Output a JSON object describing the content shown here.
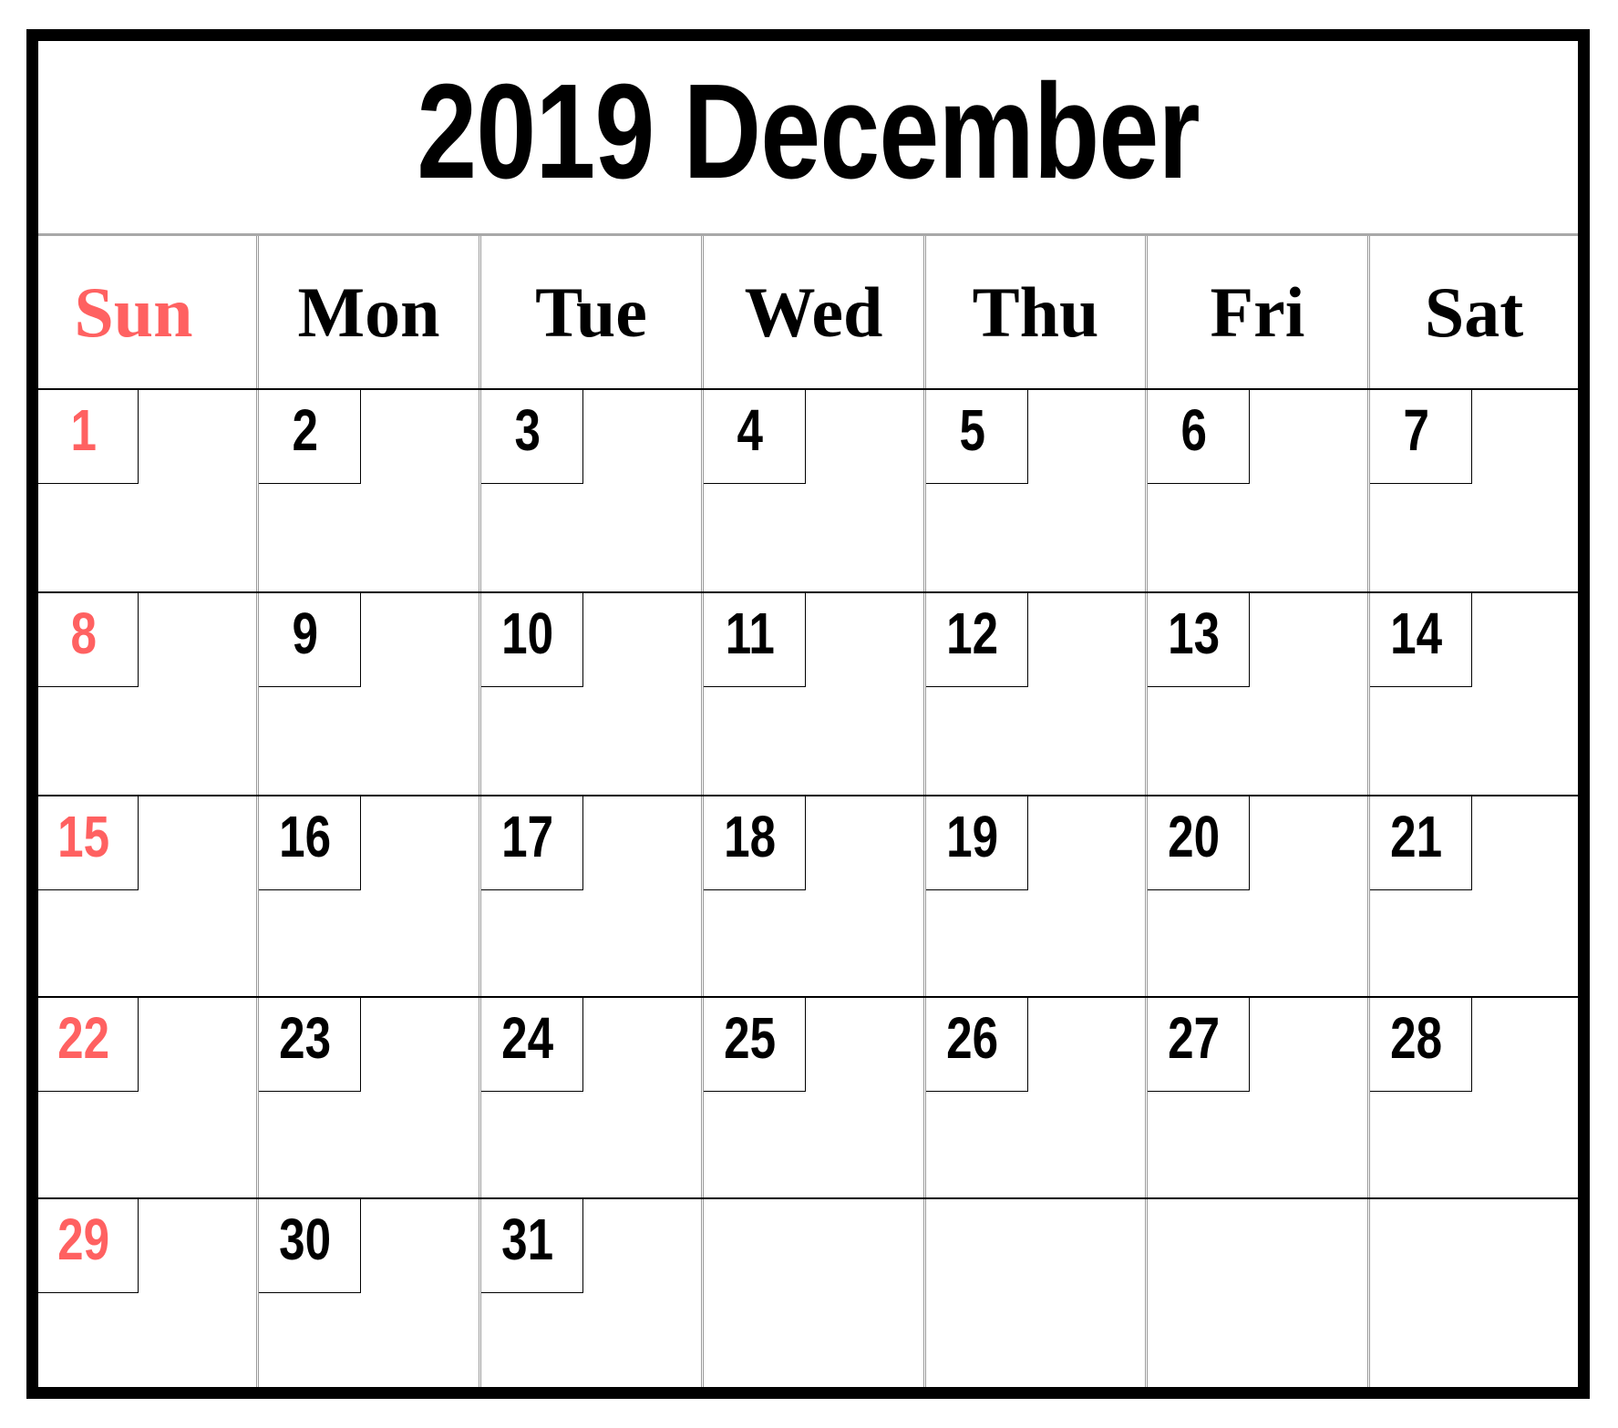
{
  "title": "2019 December",
  "colors": {
    "sunday": "#ff6161",
    "text": "#000000",
    "grid_gray": "#9a9a9a"
  },
  "weekdays": [
    {
      "label": "Sun",
      "weekend": true
    },
    {
      "label": "Mon"
    },
    {
      "label": "Tue"
    },
    {
      "label": "Wed"
    },
    {
      "label": "Thu"
    },
    {
      "label": "Fri"
    },
    {
      "label": "Sat"
    }
  ],
  "weeks": [
    [
      "1",
      "2",
      "3",
      "4",
      "5",
      "6",
      "7"
    ],
    [
      "8",
      "9",
      "10",
      "11",
      "12",
      "13",
      "14"
    ],
    [
      "15",
      "16",
      "17",
      "18",
      "19",
      "20",
      "21"
    ],
    [
      "22",
      "23",
      "24",
      "25",
      "26",
      "27",
      "28"
    ],
    [
      "29",
      "30",
      "31",
      "",
      "",
      "",
      ""
    ]
  ]
}
